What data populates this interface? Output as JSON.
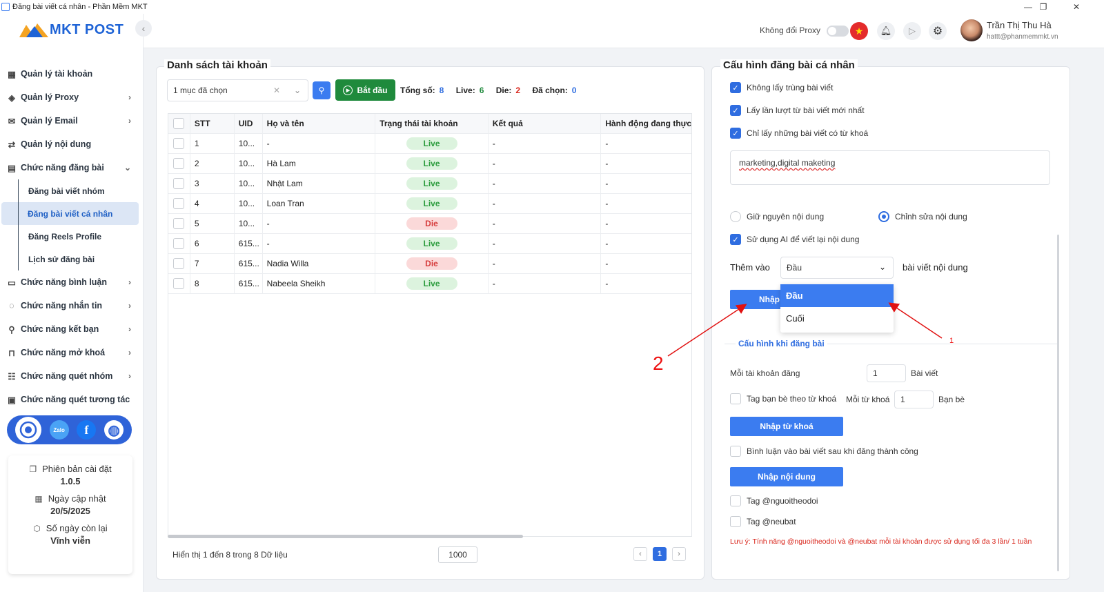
{
  "window": {
    "title": "Đăng bài viết cá nhân - Phần Mềm MKT"
  },
  "logo": {
    "text": "MKT POST"
  },
  "sidebar": {
    "items": [
      {
        "label": "Quản lý tài khoản",
        "icon": "grid-icon",
        "has_chevron": false
      },
      {
        "label": "Quản lý Proxy",
        "icon": "layers-icon",
        "has_chevron": true
      },
      {
        "label": "Quản lý Email",
        "icon": "mail-icon",
        "has_chevron": true
      },
      {
        "label": "Quản lý nội dung",
        "icon": "swap-icon",
        "has_chevron": false
      },
      {
        "label": "Chức năng đăng bài",
        "icon": "post-icon",
        "has_chevron": true,
        "expanded": true
      }
    ],
    "subitems": [
      {
        "label": "Đăng bài viết nhóm"
      },
      {
        "label": "Đăng bài viết cá nhân",
        "active": true
      },
      {
        "label": "Đăng Reels Profile"
      },
      {
        "label": "Lịch sử đăng bài"
      }
    ],
    "items2": [
      {
        "label": "Chức năng bình luận",
        "icon": "comment-icon"
      },
      {
        "label": "Chức năng nhắn tin",
        "icon": "chat-icon"
      },
      {
        "label": "Chức năng kết bạn",
        "icon": "add-friend-icon"
      },
      {
        "label": "Chức năng mở khoá",
        "icon": "lock-icon"
      },
      {
        "label": "Chức năng quét nhóm",
        "icon": "group-icon"
      },
      {
        "label": "Chức năng quét tương tác",
        "icon": "scan-icon"
      }
    ],
    "social": {
      "zalo": "Zalo",
      "facebook": "f"
    },
    "info": {
      "version_label": "Phiên bản cài đặt",
      "version_value": "1.0.5",
      "update_label": "Ngày cập nhật",
      "update_value": "20/5/2025",
      "days_label": "Số ngày còn lại",
      "days_value": "Vĩnh viễn"
    }
  },
  "topbar": {
    "proxy_label": "Không đổi Proxy",
    "user_name": "Trần Thị Thu Hà",
    "user_email": "hattt@phanmemmkt.vn"
  },
  "accounts": {
    "title": "Danh sách tài khoản",
    "select_value": "1 mục đã chọn",
    "start_label": "Bắt đầu",
    "stats": {
      "total_label": "Tổng số:",
      "total": "8",
      "live_label": "Live:",
      "live": "6",
      "die_label": "Die:",
      "die": "2",
      "selected_label": "Đã chọn:",
      "selected": "0"
    },
    "columns": [
      "STT",
      "UID",
      "Họ và tên",
      "Trạng thái tài khoản",
      "Kết quả",
      "Hành động đang thực h"
    ],
    "rows": [
      {
        "stt": "1",
        "uid": "10...",
        "name": "-",
        "status": "Live",
        "result": "-",
        "action": "-"
      },
      {
        "stt": "2",
        "uid": "10...",
        "name": "Hà Lam",
        "status": "Live",
        "result": "-",
        "action": "-"
      },
      {
        "stt": "3",
        "uid": "10...",
        "name": "Nhật Lam",
        "status": "Live",
        "result": "-",
        "action": "-"
      },
      {
        "stt": "4",
        "uid": "10...",
        "name": "Loan Tran",
        "status": "Live",
        "result": "-",
        "action": "-"
      },
      {
        "stt": "5",
        "uid": "10...",
        "name": "-",
        "status": "Die",
        "result": "-",
        "action": "-"
      },
      {
        "stt": "6",
        "uid": "615...",
        "name": "-",
        "status": "Live",
        "result": "-",
        "action": "-"
      },
      {
        "stt": "7",
        "uid": "615...",
        "name": "Nadia Willa",
        "status": "Die",
        "result": "-",
        "action": "-"
      },
      {
        "stt": "8",
        "uid": "615...",
        "name": "Nabeela Sheikh",
        "status": "Live",
        "result": "-",
        "action": "-"
      }
    ],
    "footer_text": "Hiển thị 1 đến 8 trong 8 Dữ liệu",
    "page_size": "1000",
    "page_prev": "‹",
    "page_current": "1",
    "page_next": "›"
  },
  "config": {
    "title": "Cấu hình đăng bài cá nhân",
    "cb_no_duplicate": "Không lấy trùng bài viết",
    "cb_latest": "Lấy lần lượt từ bài viết mới nhất",
    "cb_keyword_only": "Chỉ lấy những bài viết có từ khoá",
    "keywords": "marketing,digital maketing",
    "radio_keep": "Giữ nguyên nội dung",
    "radio_edit": "Chỉnh sửa nội dung",
    "cb_ai": "Sử dụng AI để viết lại nội dung",
    "add_to_label": "Thêm vào",
    "add_to_value": "Đầu",
    "add_to_suffix": "bài viết nội dung",
    "dropdown_options": [
      "Đầu",
      "Cuối"
    ],
    "import_button_partial": "Nhập",
    "section_title": "Cấu hình khi đăng bài",
    "per_account_label": "Mỗi tài khoản đăng",
    "per_account_value": "1",
    "per_account_unit": "Bài viết",
    "cb_tag_friends": "Tag bạn bè theo từ khoá",
    "per_keyword_label": "Mỗi từ khoá",
    "per_keyword_value": "1",
    "per_keyword_unit": "Bạn bè",
    "import_keyword_btn": "Nhập từ khoá",
    "cb_comment_after": "Bình luận vào bài viết sau khi đăng thành công",
    "import_content_btn": "Nhập nội dung",
    "cb_tag_followers": "Tag @nguoitheodoi",
    "cb_tag_neubat": "Tag @neubat",
    "note": "Lưu ý: Tính năng @nguoitheodoi và @neubat mỗi tài khoản được sử dụng tối đa 3 lần/ 1 tuần"
  },
  "annotations": {
    "label1": "1",
    "label2": "2"
  },
  "colors": {
    "primary": "#3b7cf0",
    "start_green": "#1f8a3c",
    "live_bg": "#dcf3de",
    "die_bg": "#fbd9d9",
    "annotation_red": "#e11111"
  }
}
